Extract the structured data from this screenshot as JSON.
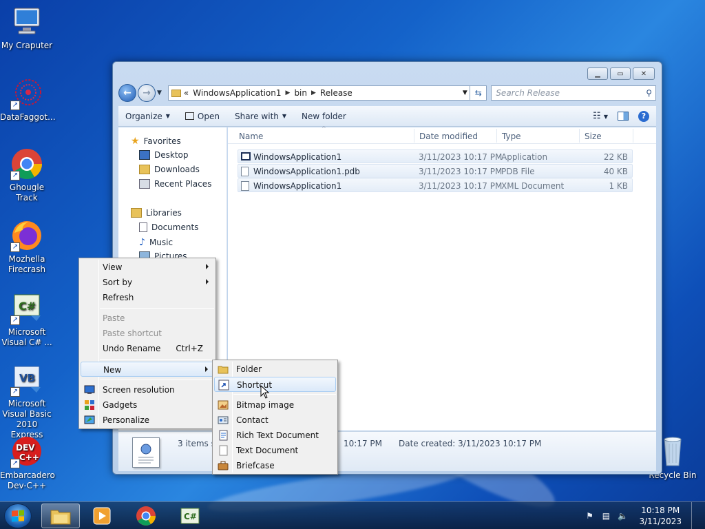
{
  "desktop": {
    "icons": [
      {
        "label": "My Craputer"
      },
      {
        "label": "DataFaggot..."
      },
      {
        "label": "Ghougle Track"
      },
      {
        "label": "Mozhella Firecrash"
      },
      {
        "label": "Microsoft Visual C# ..."
      },
      {
        "label": "Microsoft Visual Basic 2010 Express"
      },
      {
        "label": "Embarcadero Dev-C++"
      },
      {
        "label": "Recycle Bin"
      }
    ]
  },
  "explorer": {
    "address": {
      "prefix": "«",
      "segments": [
        "WindowsApplication1",
        "bin",
        "Release"
      ]
    },
    "search_placeholder": "Search Release",
    "toolbar": {
      "organize": "Organize",
      "open": "Open",
      "share_with": "Share with",
      "new_folder": "New folder"
    },
    "nav": {
      "favorites": "Favorites",
      "desktop": "Desktop",
      "downloads": "Downloads",
      "recent_places": "Recent Places",
      "libraries": "Libraries",
      "documents": "Documents",
      "music": "Music",
      "pictures": "Pictures"
    },
    "columns": {
      "name": "Name",
      "date": "Date modified",
      "type": "Type",
      "size": "Size"
    },
    "files": [
      {
        "name": "WindowsApplication1",
        "date": "3/11/2023 10:17 PM",
        "type": "Application",
        "size": "22 KB"
      },
      {
        "name": "WindowsApplication1.pdb",
        "date": "3/11/2023 10:17 PM",
        "type": "PDB File",
        "size": "40 KB"
      },
      {
        "name": "WindowsApplication1",
        "date": "3/11/2023 10:17 PM",
        "type": "XML Document",
        "size": "1 KB"
      }
    ],
    "details": {
      "items_selected": "3 items se",
      "modified_tail": "10:17 PM",
      "date_created": "Date created: 3/11/2023 10:17 PM"
    }
  },
  "context_menu": {
    "view": "View",
    "sort_by": "Sort by",
    "refresh": "Refresh",
    "paste": "Paste",
    "paste_shortcut": "Paste shortcut",
    "undo_rename": "Undo Rename",
    "undo_rename_shortcut": "Ctrl+Z",
    "new": "New",
    "screen_resolution": "Screen resolution",
    "gadgets": "Gadgets",
    "personalize": "Personalize"
  },
  "new_submenu": {
    "folder": "Folder",
    "shortcut": "Shortcut",
    "bitmap_image": "Bitmap image",
    "contact": "Contact",
    "rich_text_document": "Rich Text Document",
    "text_document": "Text Document",
    "briefcase": "Briefcase"
  },
  "taskbar": {
    "time": "10:18 PM",
    "date": "3/11/2023"
  }
}
